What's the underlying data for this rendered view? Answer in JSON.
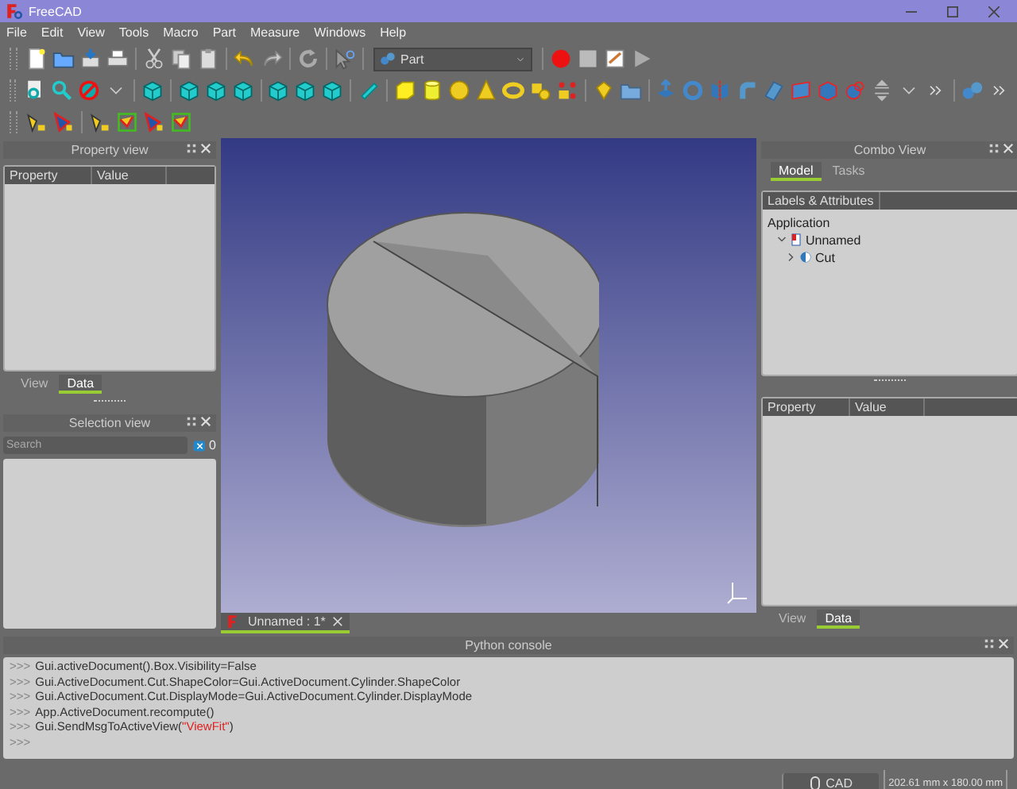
{
  "window": {
    "title": "FreeCAD"
  },
  "menu": [
    "File",
    "Edit",
    "View",
    "Tools",
    "Macro",
    "Part",
    "Measure",
    "Windows",
    "Help"
  ],
  "workbench": {
    "value": "Part"
  },
  "property_view": {
    "title": "Property view",
    "columns": [
      "Property",
      "Value"
    ],
    "tabs": [
      {
        "label": "View",
        "selected": false
      },
      {
        "label": "Data",
        "selected": true
      }
    ]
  },
  "selection_view": {
    "title": "Selection view",
    "search": {
      "placeholder": "Search"
    },
    "count": "0"
  },
  "document_tabs": [
    {
      "label": "Unnamed : 1*",
      "selected": true
    }
  ],
  "combo_view": {
    "title": "Combo View",
    "tabs": [
      {
        "label": "Model",
        "selected": true
      },
      {
        "label": "Tasks",
        "selected": false
      }
    ],
    "tree_header": "Labels & Attributes",
    "tree": {
      "label": "Application",
      "children": [
        {
          "label": "Unnamed",
          "expanded": true,
          "children": [
            {
              "label": "Cut",
              "expanded": false
            }
          ]
        }
      ]
    },
    "property_columns": [
      "Property",
      "Value"
    ],
    "property_tabs": [
      {
        "label": "View",
        "selected": false
      },
      {
        "label": "Data",
        "selected": true
      }
    ]
  },
  "python_console": {
    "title": "Python console",
    "lines": [
      {
        "prompt": ">>>",
        "segments": [
          {
            "kind": "code",
            "text": "Gui.activeDocument().Box.Visibility=False"
          }
        ]
      },
      {
        "prompt": ">>>",
        "segments": [
          {
            "kind": "code",
            "text": "Gui.ActiveDocument.Cut.ShapeColor=Gui.ActiveDocument.Cylinder.ShapeColor"
          }
        ]
      },
      {
        "prompt": ">>>",
        "segments": [
          {
            "kind": "code",
            "text": "Gui.ActiveDocument.Cut.DisplayMode=Gui.ActiveDocument.Cylinder.DisplayMode"
          }
        ]
      },
      {
        "prompt": ">>>",
        "segments": [
          {
            "kind": "code",
            "text": "App.ActiveDocument.recompute()"
          }
        ]
      },
      {
        "prompt": ">>>",
        "segments": [
          {
            "kind": "code",
            "text": "Gui.SendMsgToActiveView("
          },
          {
            "kind": "string",
            "text": "\"ViewFit\""
          },
          {
            "kind": "code",
            "text": ")"
          }
        ]
      },
      {
        "prompt": ">>>"
      }
    ]
  },
  "status_bar": {
    "navigation": "CAD",
    "dimensions": "202.61 mm x 180.00 mm"
  }
}
